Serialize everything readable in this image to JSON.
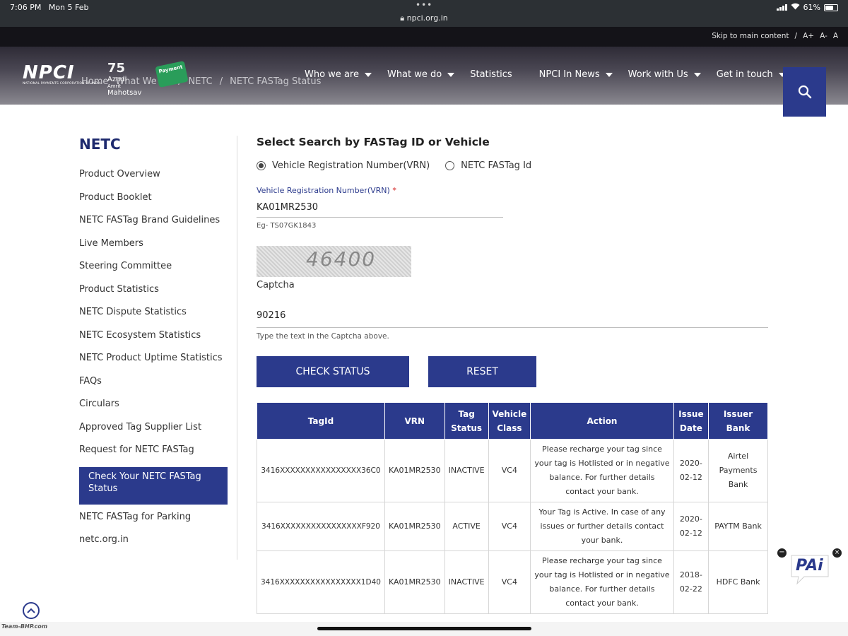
{
  "status_bar": {
    "time": "7:06 PM",
    "date": "Mon 5 Feb",
    "dots": "•••",
    "url": "npci.org.in",
    "battery": "61%",
    "battery_level": 0.61
  },
  "header": {
    "utility_links": [
      "Skip to main content",
      "/",
      "A+",
      "A-",
      "A"
    ],
    "logo_text": "NPCI",
    "logo_subtext": "NATIONAL PAYMENTS CORPORATION OF INDIA",
    "azadi_lines": [
      "Azadi",
      "Amrit",
      "Mahotsav"
    ],
    "badge_text": "Payment",
    "breadcrumb_ghost": [
      "Home",
      "What We do",
      "/",
      "NETC",
      "/",
      "NETC FASTag Status"
    ],
    "nav": [
      {
        "label": "Who we are",
        "dropdown": true
      },
      {
        "label": "What we do",
        "dropdown": true
      },
      {
        "label": "Statistics",
        "dropdown": false
      },
      {
        "label": "NPCI In News",
        "dropdown": true
      },
      {
        "label": "Work with Us",
        "dropdown": true
      },
      {
        "label": "Get in touch",
        "dropdown": true
      }
    ]
  },
  "sidebar": {
    "title": "NETC",
    "items": [
      "Product Overview",
      "Product Booklet",
      "NETC FASTag Brand Guidelines",
      "Live Members",
      "Steering Committee",
      "Product Statistics",
      "NETC Dispute Statistics",
      "NETC Ecosystem Statistics",
      "NETC Product Uptime Statistics",
      "FAQs",
      "Circulars",
      "Approved Tag Supplier List",
      "Request for NETC FASTag",
      "Check Your NETC FASTag Status",
      "NETC FASTag for Parking",
      "netc.org.in"
    ],
    "active_index": 13
  },
  "form": {
    "title": "Select Search by FASTag ID or Vehicle",
    "radio_vrn": "Vehicle Registration Number(VRN)",
    "radio_tag": "NETC FASTag Id",
    "vrn_label": "Vehicle Registration Number(VRN)",
    "required_mark": "*",
    "vrn_value": "KA01MR2530",
    "vrn_hint": "Eg- TS07GK1843",
    "captcha_image_text": "46400",
    "captcha_label": "Captcha",
    "captcha_value": "90216",
    "captcha_hint": "Type the text in the Captcha above.",
    "check_button": "CHECK STATUS",
    "reset_button": "RESET"
  },
  "results": {
    "headers": [
      "TagId",
      "VRN",
      "Tag Status",
      "Vehicle Class",
      "Action",
      "Issue Date",
      "Issuer Bank"
    ],
    "rows": [
      {
        "tagid": "3416XXXXXXXXXXXXXXXX36C0",
        "vrn": "KA01MR2530",
        "status": "INACTIVE",
        "class": "VC4",
        "action": "Please recharge your tag since your tag is Hotlisted or in negative balance. For further details contact your bank.",
        "date": "2020-02-12",
        "bank": "Airtel Payments Bank"
      },
      {
        "tagid": "3416XXXXXXXXXXXXXXXXF920",
        "vrn": "KA01MR2530",
        "status": "ACTIVE",
        "class": "VC4",
        "action": "Your Tag is Active. In case of any issues or further details contact your bank.",
        "date": "2020-02-12",
        "bank": "PAYTM Bank"
      },
      {
        "tagid": "3416XXXXXXXXXXXXXXXX1D40",
        "vrn": "KA01MR2530",
        "status": "INACTIVE",
        "class": "VC4",
        "action": "Please recharge your tag since your tag is Hotlisted or in negative balance. For further details contact your bank.",
        "date": "2018-02-22",
        "bank": "HDFC Bank"
      }
    ]
  },
  "widgets": {
    "pai_text": "PAi",
    "minus": "−",
    "close": "×"
  },
  "watermark": "Team-BHP.com",
  "colors": {
    "brand_blue": "#2b3a8c",
    "title_blue": "#1e2a6e",
    "required_red": "#d32020"
  }
}
